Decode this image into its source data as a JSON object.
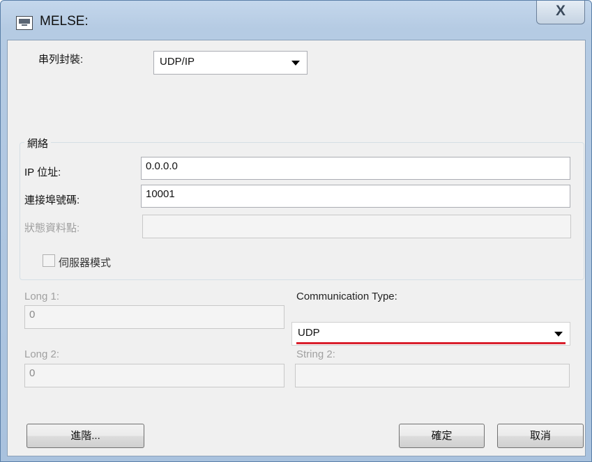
{
  "window": {
    "title": "MELSE:",
    "close_label": "X"
  },
  "serial": {
    "label": "串列封裝:",
    "value": "UDP/IP"
  },
  "network": {
    "group_label": "網絡",
    "ip_label": "IP 位址:",
    "ip_value": "0.0.0.0",
    "port_label": "連接埠號碼:",
    "port_value": "10001",
    "status_label": "狀態資料點:",
    "status_value": "",
    "server_mode_label": "伺服器模式",
    "server_mode_checked": false
  },
  "long1": {
    "label": "Long 1:",
    "value": "0"
  },
  "long2": {
    "label": "Long 2:",
    "value": "0"
  },
  "comm_type": {
    "label": "Communication Type:",
    "value": "UDP"
  },
  "string2": {
    "label": "String 2:",
    "value": ""
  },
  "buttons": {
    "advanced": "進階...",
    "ok": "確定",
    "cancel": "取消"
  },
  "colors": {
    "accent_underline": "#d9202d",
    "title_gradient_top": "#c4d7ec"
  }
}
